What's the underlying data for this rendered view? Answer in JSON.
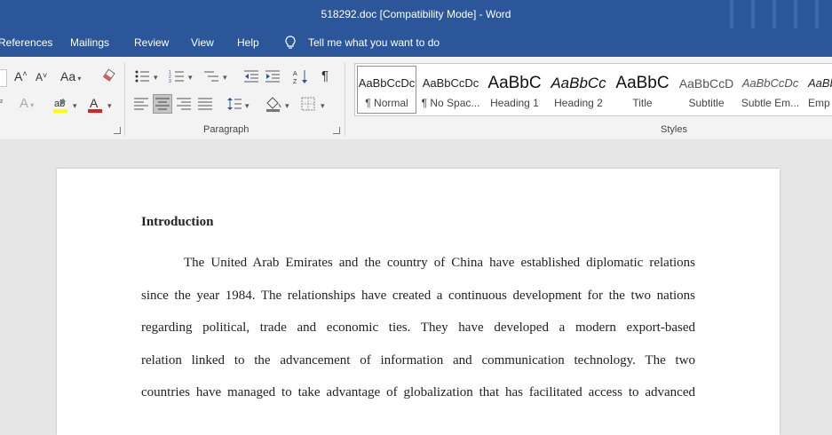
{
  "titlebar": {
    "title": "518292.doc [Compatibility Mode]  -  Word"
  },
  "menu": {
    "tabs": [
      "References",
      "Mailings",
      "Review",
      "View",
      "Help"
    ],
    "tell_me": "Tell me what you want to do"
  },
  "ribbon": {
    "font_group": {
      "change_case": "Aa"
    },
    "paragraph_label": "Paragraph",
    "styles_label": "Styles",
    "styles": [
      {
        "preview": "AaBbCcDc",
        "name": "¶ Normal"
      },
      {
        "preview": "AaBbCcDc",
        "name": "¶ No Spac..."
      },
      {
        "preview": "AaBbC",
        "name": "Heading 1"
      },
      {
        "preview": "AaBbCc",
        "name": "Heading 2"
      },
      {
        "preview": "AaBbC",
        "name": "Title"
      },
      {
        "preview": "AaBbCcD",
        "name": "Subtitle"
      },
      {
        "preview": "AaBbCcDc",
        "name": "Subtle Em..."
      },
      {
        "preview": "AaBbCcDc",
        "name": "Emp"
      }
    ]
  },
  "document": {
    "heading": "Introduction",
    "lines": [
      "The United Arab Emirates and the country of China have established diplomatic relations",
      "since the year 1984. The relationships have created a continuous development for the two nations",
      "regarding political, trade and economic ties. They have developed a modern export-based",
      "relation linked to the advancement of information and communication technology. The two",
      "countries have managed to take advantage of globalization that has facilitated access to advanced"
    ]
  }
}
